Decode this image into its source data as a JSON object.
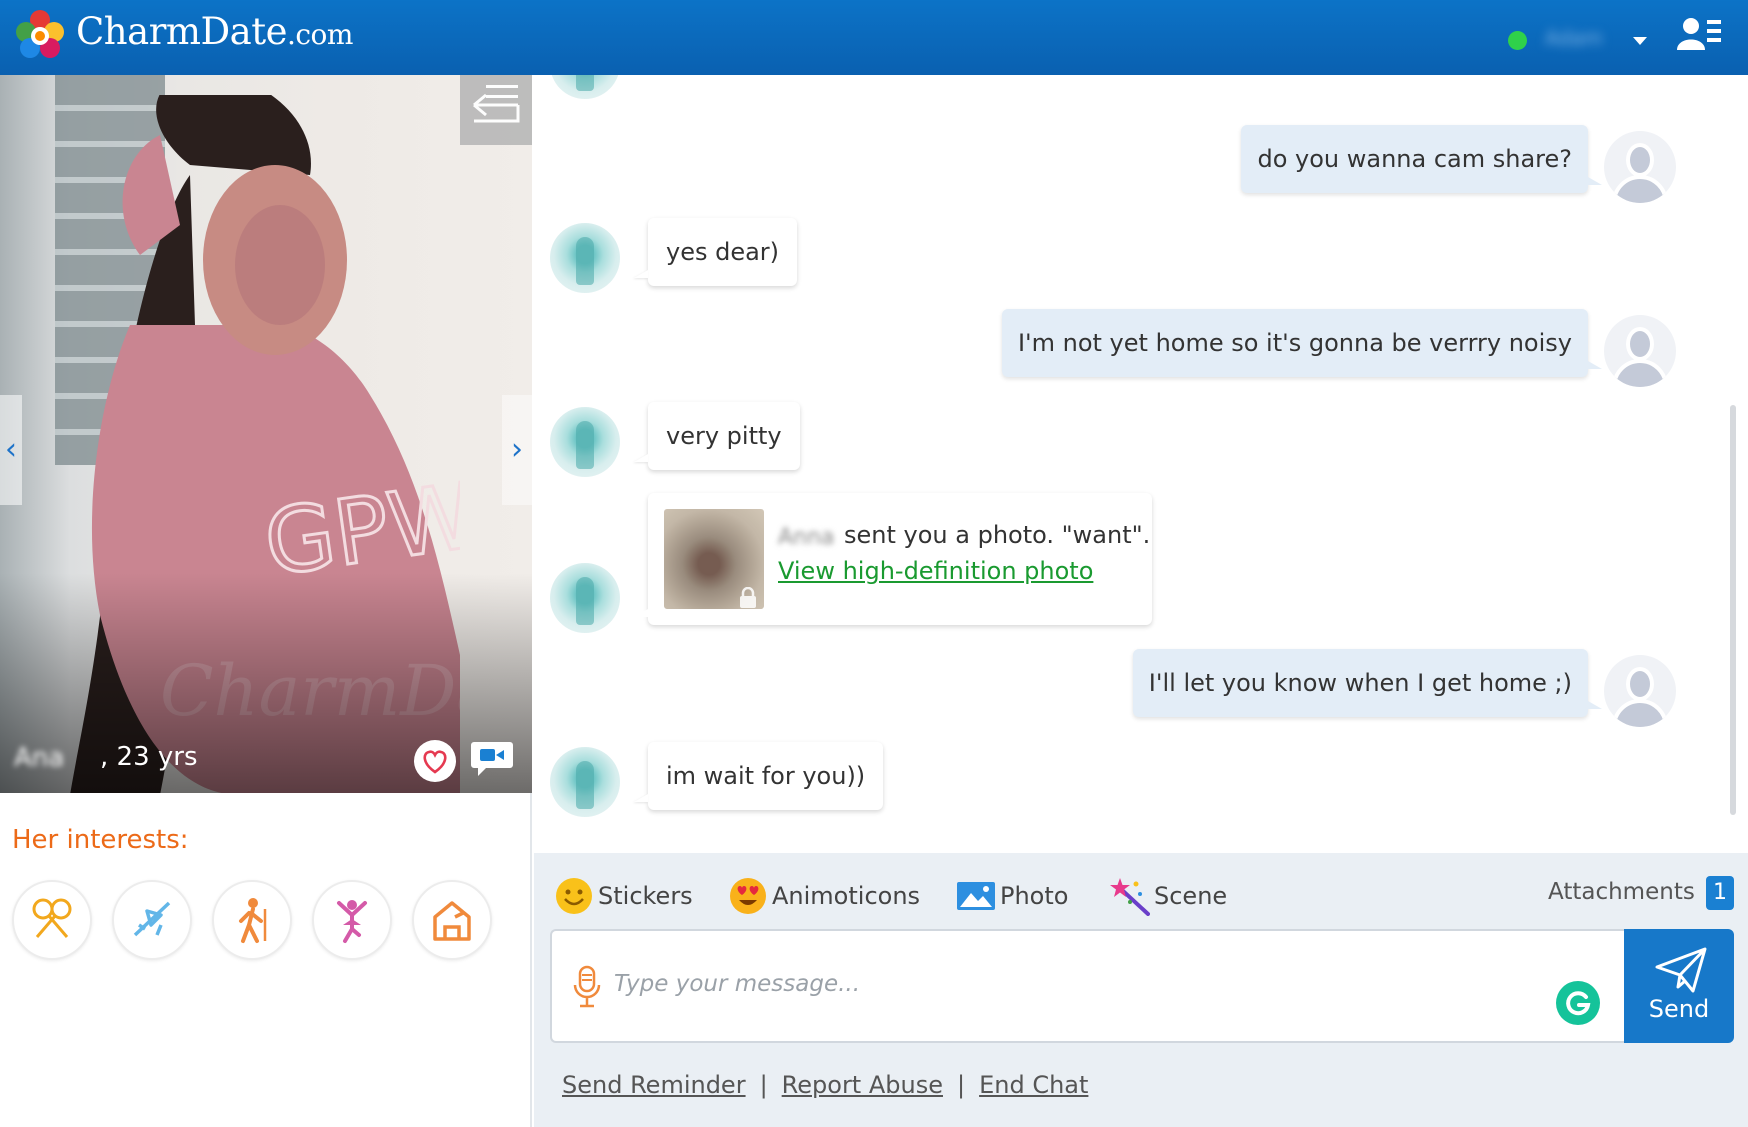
{
  "header": {
    "logo_main": "CharmDate",
    "logo_domain": ".com",
    "user_name": "Adam",
    "colors": {
      "bar": "#0c73c7",
      "online": "#2fd14a"
    }
  },
  "profile": {
    "name": "Ana",
    "age": ", 23 yrs",
    "prev_glyph": "‹",
    "next_glyph": "›",
    "interests_title": "Her interests:",
    "interests": [
      "badminton-icon",
      "airplane-icon",
      "hiking-icon",
      "dance-icon",
      "pet-dog-icon"
    ]
  },
  "chat": {
    "messages": [
      {
        "from": "me",
        "text": "do you wanna cam share?"
      },
      {
        "from": "her",
        "text": "yes dear)"
      },
      {
        "from": "me",
        "text": "I'm not yet home so it's gonna be verrry noisy"
      },
      {
        "from": "her",
        "text": "very pitty"
      },
      {
        "from": "her",
        "type": "photo",
        "sender": "Anna",
        "text": "sent you a photo. \"want\".",
        "link": "View high-definition photo"
      },
      {
        "from": "me",
        "text": "I'll let you know when I get home ;)"
      },
      {
        "from": "her",
        "text": "im wait for you))"
      }
    ]
  },
  "input": {
    "tools": [
      "Stickers",
      "Animoticons",
      "Photo",
      "Scene"
    ],
    "attachments_label": "Attachments",
    "attachments_count": "1",
    "placeholder": "Type your message...",
    "send_label": "Send",
    "footer_links": [
      "Send Reminder",
      "Report Abuse",
      "End Chat"
    ],
    "separator": "|"
  }
}
